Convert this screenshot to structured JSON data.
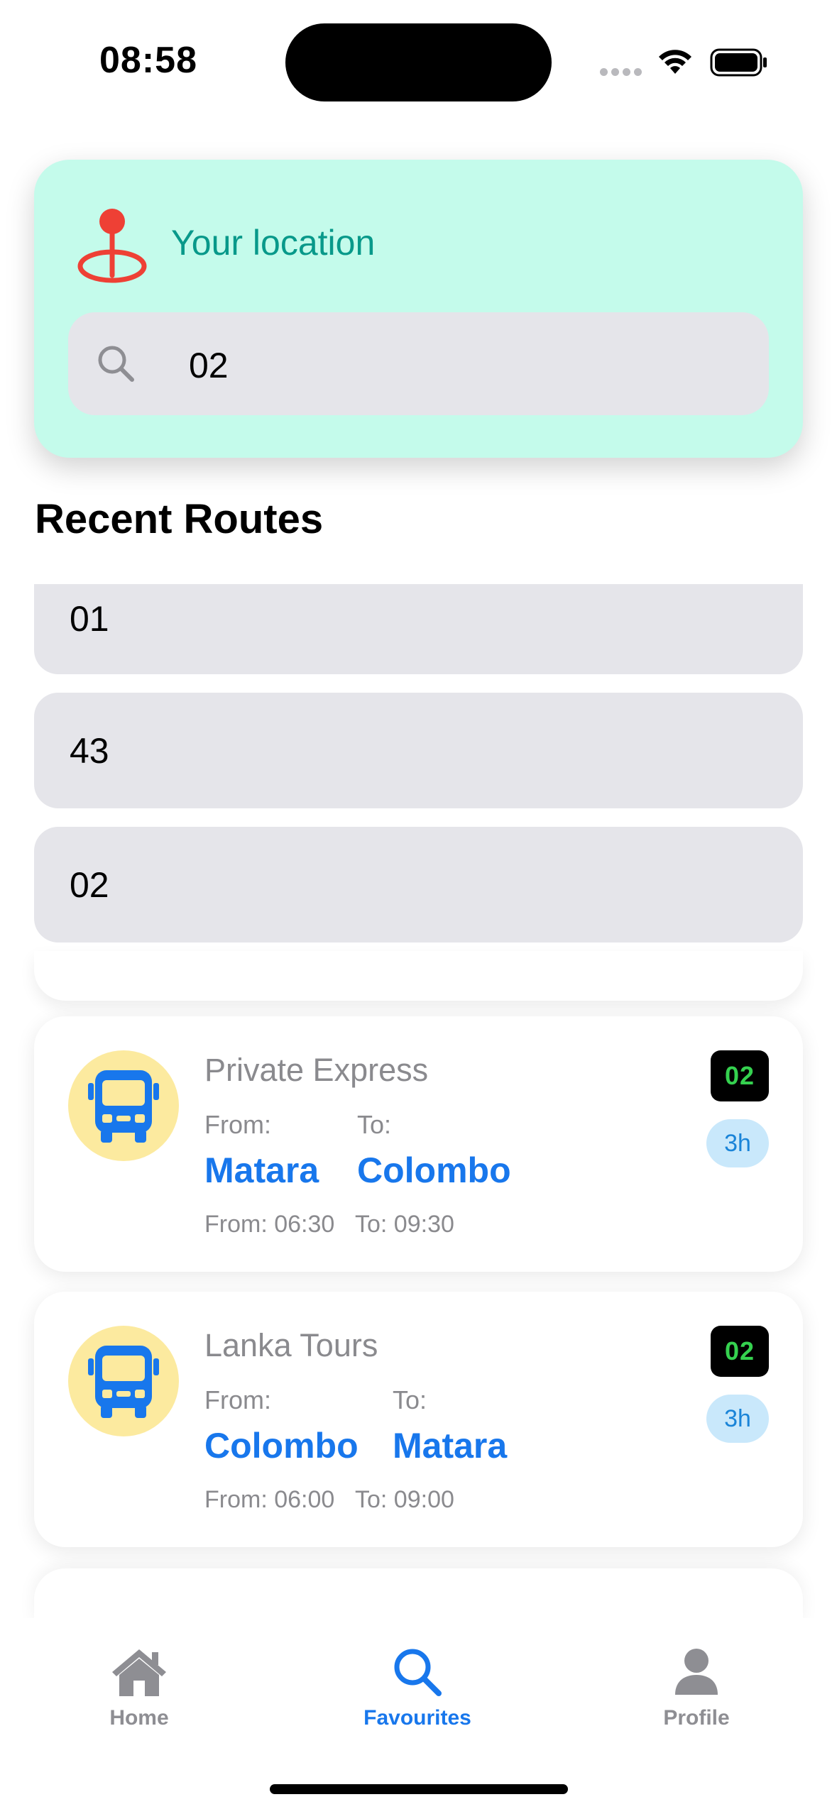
{
  "status_bar": {
    "time": "08:58",
    "icons": [
      "signal-icon",
      "wifi-icon",
      "battery-icon"
    ]
  },
  "location": {
    "title": "Your location",
    "icon": "location-pin-icon",
    "search": {
      "value": "02",
      "icon": "search-icon"
    }
  },
  "recent": {
    "title": "Recent Routes",
    "items": [
      {
        "label": "01"
      },
      {
        "label": "43"
      },
      {
        "label": "02"
      }
    ]
  },
  "routes": [
    {
      "operator": "Private Express",
      "from_label": "From:",
      "to_label": "To:",
      "from_city": "Matara",
      "to_city": "Colombo",
      "depart": "From: 06:30",
      "arrive": "To: 09:30",
      "route_no": "02",
      "duration": "3h",
      "icon": "bus-icon"
    },
    {
      "operator": "Lanka Tours",
      "from_label": "From:",
      "to_label": "To:",
      "from_city": "Colombo",
      "to_city": "Matara",
      "depart": "From: 06:00",
      "arrive": "To: 09:00",
      "route_no": "02",
      "duration": "3h",
      "icon": "bus-icon"
    }
  ],
  "tabs": [
    {
      "label": "Home",
      "icon": "home-icon",
      "active": false
    },
    {
      "label": "Favourites",
      "icon": "search-icon",
      "active": true
    },
    {
      "label": "Profile",
      "icon": "person-icon",
      "active": false
    }
  ],
  "colors": {
    "card_bg": "#c4fbeb",
    "accent_teal": "#08998a",
    "accent_blue": "#1877ec",
    "route_badge_text": "#35d14f",
    "avatar_bg": "#fcea9f"
  }
}
